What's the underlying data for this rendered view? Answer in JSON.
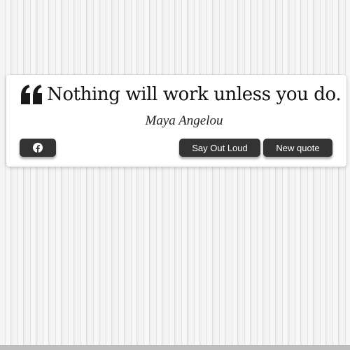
{
  "quote": {
    "text": "Nothing will work unless you do.",
    "author": "Maya Angelou"
  },
  "buttons": {
    "facebook_icon": "facebook-icon",
    "say_out_loud": "Say Out Loud",
    "new_quote": "New quote"
  },
  "colors": {
    "button_bg": "#333333",
    "button_text": "#ffffff",
    "card_bg": "#ffffff"
  }
}
